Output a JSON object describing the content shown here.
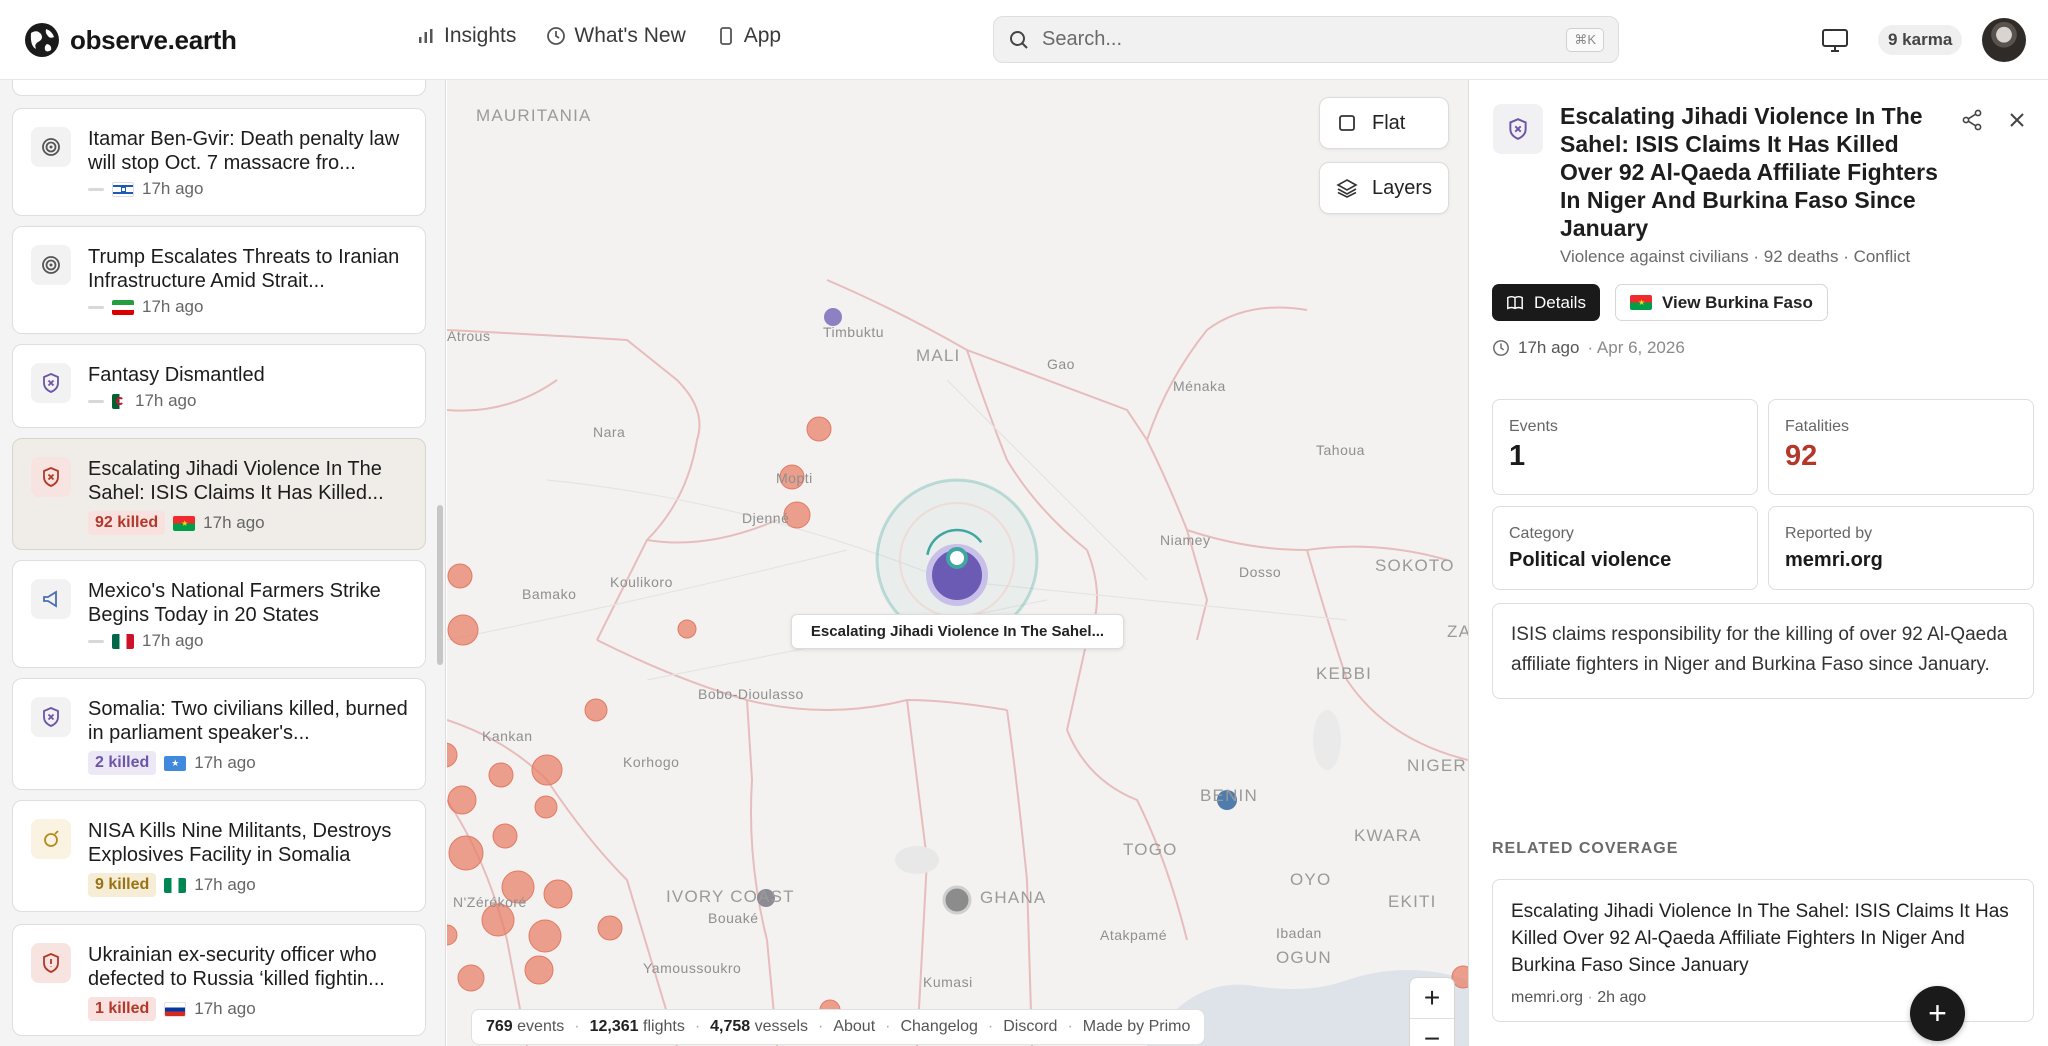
{
  "header": {
    "logo_text": "observe.earth",
    "nav": [
      {
        "label": "Insights",
        "icon": "bar-chart-icon"
      },
      {
        "label": "What's New",
        "icon": "clock-icon"
      },
      {
        "label": "App",
        "icon": "phone-icon"
      }
    ],
    "search_placeholder": "Search...",
    "search_shortcut": "⌘K",
    "karma": "9 karma"
  },
  "sidebar": {
    "items": [
      {
        "title": "Itamar Ben-Gvir: Death penalty law will stop Oct. 7 massacre fro...",
        "time": "17h ago",
        "icon": "target-icon",
        "flag": "israel",
        "killed": ""
      },
      {
        "title": "Trump Escalates Threats to Iranian Infrastructure Amid Strait...",
        "time": "17h ago",
        "icon": "target-icon",
        "flag": "iran",
        "killed": ""
      },
      {
        "title": "Fantasy Dismantled",
        "time": "17h ago",
        "icon": "shield-x-icon",
        "flag": "algeria",
        "killed": ""
      },
      {
        "title": "Escalating Jihadi Violence In The Sahel: ISIS Claims It Has Killed...",
        "time": "17h ago",
        "icon": "shield-x-icon",
        "flag": "burkina-faso",
        "killed": "92 killed"
      },
      {
        "title": "Mexico's National Farmers Strike Begins Today in 20 States",
        "time": "17h ago",
        "icon": "megaphone-icon",
        "flag": "mexico",
        "killed": ""
      },
      {
        "title": "Somalia: Two civilians killed, burned in parliament speaker's...",
        "time": "17h ago",
        "icon": "shield-x-icon",
        "flag": "somalia",
        "killed": "2 killed"
      },
      {
        "title": "NISA Kills Nine Militants, Destroys Explosives Facility in Somalia",
        "time": "17h ago",
        "icon": "blast-icon",
        "flag": "nigeria",
        "killed": "9 killed"
      },
      {
        "title": "Ukrainian ex-security officer who defected to Russia ‘killed fightin...",
        "time": "17h ago",
        "icon": "shield-x-icon",
        "flag": "russia",
        "killed": "1 killed"
      }
    ]
  },
  "map": {
    "flat_label": "Flat",
    "layers_label": "Layers",
    "tooltip": "Escalating Jihadi Violence In The Sahel...",
    "labels": {
      "mauritania": "MAURITANIA",
      "mali": "MALI",
      "ghana": "GHANA",
      "togo": "TOGO",
      "benin": "BENIN",
      "ivory_coast": "IVORY COAST",
      "kebbi": "KEBBI",
      "sokoto": "SOKOTO",
      "kwara": "KWARA",
      "oyo": "OYO",
      "ekiti": "EKITI",
      "ogun": "OGUN",
      "niger": "NIGER",
      "zam": "ZAM",
      "timbuktu": "Timbuktu",
      "gao": "Gao",
      "menaka": "Ménaka",
      "tahoua": "Tahoua",
      "niamey": "Niamey",
      "dosso": "Dosso",
      "nara": "Nara",
      "mopti": "Mopti",
      "djenne": "Djenné",
      "koulikoro": "Koulikoro",
      "bamako": "Bamako",
      "bobo": "Bobo-Dioulasso",
      "korhogo": "Korhogo",
      "kankan": "Kankan",
      "nzerekore": "N'Zérékoré",
      "bouake": "Bouaké",
      "yamoussoukro": "Yamoussoukro",
      "kumasi": "Kumasi",
      "atakpame": "Atakpamé",
      "ibadan": "Ibadan",
      "atrous": "Atrous"
    },
    "status": {
      "events": "769",
      "events_label": "events",
      "flights": "12,361",
      "flights_label": "flights",
      "vessels": "4,758",
      "vessels_label": "vessels",
      "about": "About",
      "changelog": "Changelog",
      "discord": "Discord",
      "made_by": "Made by Primo"
    }
  },
  "panel": {
    "title": "Escalating Jihadi Violence In The Sahel: ISIS Claims It Has Killed Over 92 Al-Qaeda Affiliate Fighters In Niger And Burkina Faso Since January",
    "subtitle": "Violence against civilians · 92 deaths · Conflict",
    "details_label": "Details",
    "view_label": "View Burkina Faso",
    "time": "17h ago",
    "date": "· Apr 6, 2026",
    "stats": {
      "events_label": "Events",
      "events_value": "1",
      "fatalities_label": "Fatalities",
      "fatalities_value": "92",
      "category_label": "Category",
      "category_value": "Political violence",
      "reported_label": "Reported by",
      "reported_value": "memri.org"
    },
    "description": "ISIS claims responsibility for the killing of over 92 Al-Qaeda affiliate fighters in Niger and Burkina Faso since January.",
    "related_header": "RELATED COVERAGE",
    "related": {
      "title": "Escalating Jihadi Violence In The Sahel: ISIS Claims It Has Killed Over 92 Al-Qaeda Affiliate Fighters In Niger And Burkina Faso Since January",
      "source": "memri.org",
      "time": "2h ago"
    }
  },
  "colors": {
    "accent_red": "#b3382a",
    "marker_orange": "#e8826a",
    "marker_purple": "#6b5bb5",
    "marker_teal": "#3fa6a0"
  }
}
